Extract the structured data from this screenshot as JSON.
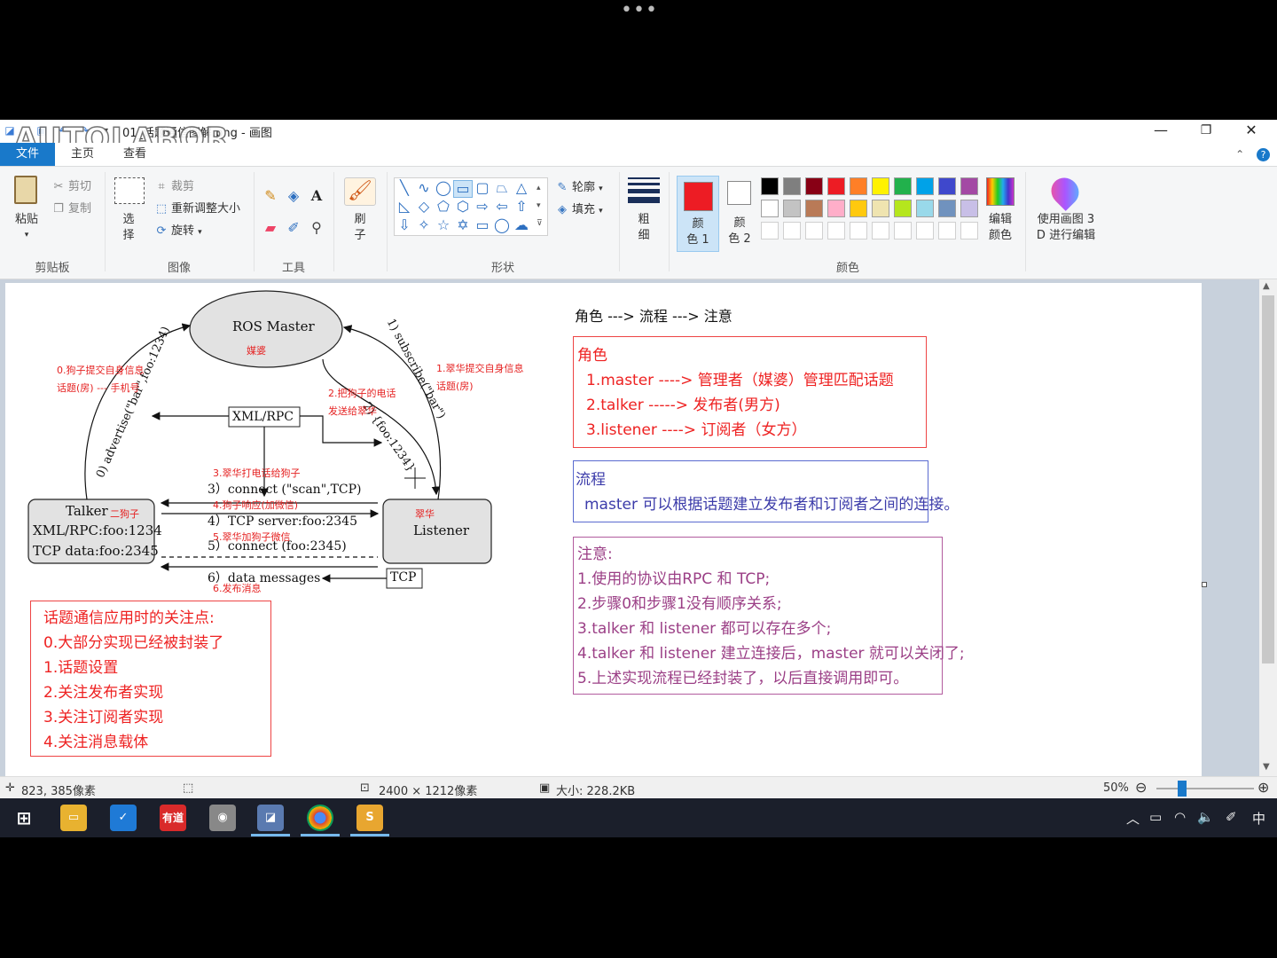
{
  "window": {
    "title": "01_话题通信图解.png - 画图",
    "watermark": "AUTOLABOR",
    "min": "—",
    "max": "❐",
    "close": "✕"
  },
  "tabs": {
    "file": "文件",
    "home": "主页",
    "view": "查看"
  },
  "ribbon": {
    "paste": "粘贴",
    "cut": "剪切",
    "copy": "复制",
    "select_top": "选",
    "select_bottom": "择",
    "crop": "裁剪",
    "resize": "重新调整大小",
    "rotate": "旋转",
    "brush_top": "刷",
    "brush_bottom": "子",
    "outline": "轮廓",
    "fill": "填充",
    "size_top": "粗",
    "size_bottom": "细",
    "color1_top": "颜",
    "color1_bottom": "色 1",
    "color2_top": "颜",
    "color2_bottom": "色 2",
    "edit_colors_top": "编辑",
    "edit_colors_bottom": "颜色",
    "paint3d_top": "使用画图 3",
    "paint3d_bottom": "D 进行编辑",
    "groups": {
      "clipboard": "剪贴板",
      "image": "图像",
      "tools": "工具",
      "shapes": "形状",
      "colors": "颜色"
    },
    "palette_row1": [
      "#000000",
      "#7f7f7f",
      "#880015",
      "#ed1c24",
      "#ff7f27",
      "#fff200",
      "#22b14c",
      "#00a2e8",
      "#3f48cc",
      "#a349a4"
    ],
    "palette_row2": [
      "#ffffff",
      "#c3c3c3",
      "#b97a57",
      "#ffaec9",
      "#ffc90e",
      "#efe4b0",
      "#b5e61d",
      "#99d9ea",
      "#7092be",
      "#c8bfe7"
    ]
  },
  "diagram": {
    "ros_master": "ROS Master",
    "ros_master_sub": "媒婆",
    "talker": "Talker",
    "talker_sub": "二狗子",
    "talker_line2": "XML/RPC:foo:1234",
    "talker_line3": "TCP data:foo:2345",
    "listener": "Listener",
    "listener_sub": "翠华",
    "xmlrpc": "XML/RPC",
    "tcp": "TCP",
    "step0": "0) advertise(\"bar\",foo:1234)",
    "step1": "1) subscribe(\"bar\")",
    "step2": "2) {foo:1234}",
    "step3": "3）connect (\"scan\",TCP)",
    "step4": "4）TCP server:foo:2345",
    "step5": "5）connect (foo:2345)",
    "step6": "6）data messages",
    "note0a": "0.狗子提交自身信息",
    "note0b": "话题(房) --- 手机号",
    "note1a": "1.翠华提交自身信息",
    "note1b": "话题(房)",
    "note2a": "2.把狗子的电话",
    "note2b": "发送给翠华",
    "note3": "3.翠华打电话给狗子",
    "note4": "4.狗子响应(加微信)",
    "note5": "5.翠华加狗子微信",
    "note6": "6.发布消息"
  },
  "notes_box": {
    "title": "话题通信应用时的关注点:",
    "items": [
      "0.大部分实现已经被封装了",
      "1.话题设置",
      "2.关注发布者实现",
      "3.关注订阅者实现",
      "4.关注消息载体"
    ]
  },
  "right_panel": {
    "header": "角色 ---> 流程 ---> 注意",
    "roles_title": "角色",
    "roles": [
      "1.master  ----> 管理者（媒婆）管理匹配话题",
      "2.talker   -----> 发布者(男方)",
      "3.listener ----> 订阅者（女方）"
    ],
    "flow_title": "流程",
    "flow_text": "master 可以根据话题建立发布者和订阅者之间的连接。",
    "notes_title": "注意:",
    "notes": [
      "1.使用的协议由RPC 和 TCP;",
      "2.步骤0和步骤1没有顺序关系;",
      "3.talker 和 listener 都可以存在多个;",
      "4.talker 和 listener 建立连接后，master 就可以关闭了;",
      "5.上述实现流程已经封装了，以后直接调用即可。"
    ]
  },
  "statusbar": {
    "cursor": "823, 385像素",
    "dimensions": "2400 × 1212像素",
    "size": "大小: 228.2KB",
    "zoom": "50%"
  },
  "taskbar": {
    "youdao": "有道",
    "ime": "中"
  }
}
